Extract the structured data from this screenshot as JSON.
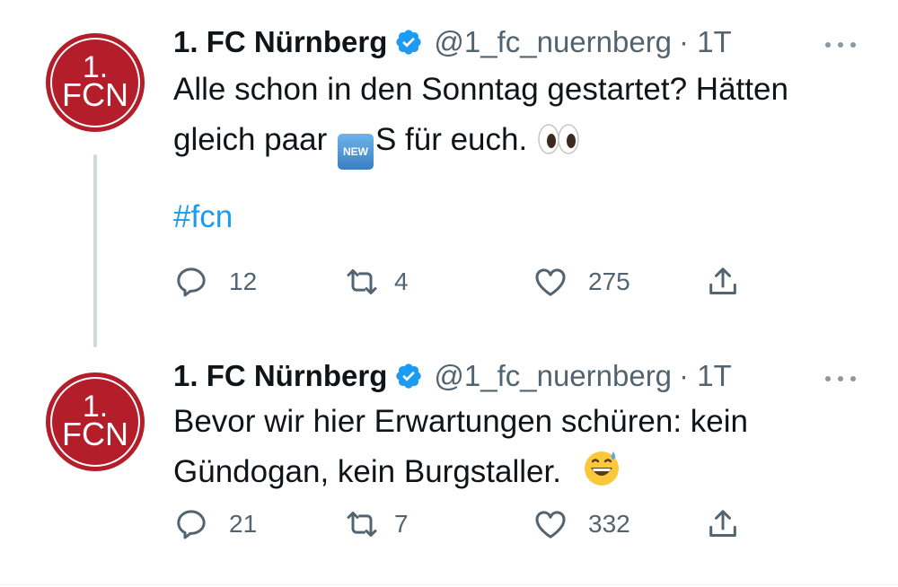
{
  "tweets": [
    {
      "name": "1. FC Nürnberg",
      "handle": "@1_fc_nuernberg",
      "time": "· 1T",
      "text_part1": "Alle schon in den Sonntag gestartet? Hätten",
      "text_part2a": "gleich paar ",
      "new_badge": "NEW",
      "text_part2b": "S für euch.",
      "hashtag": "#fcn",
      "replies": "12",
      "retweets": "4",
      "likes": "275",
      "emoji": "eyes-icon"
    },
    {
      "name": "1. FC Nürnberg",
      "handle": "@1_fc_nuernberg",
      "time": "· 1T",
      "text_part1": "Bevor wir hier Erwartungen schüren: kein",
      "text_part2a": "Gündogan, kein Burgstaller.",
      "replies": "21",
      "retweets": "7",
      "likes": "332",
      "emoji": "grinning-sweat-icon"
    }
  ],
  "avatar_text_top": "1.",
  "avatar_text_bottom": "FCN",
  "colors": {
    "brand_red": "#b41e2a",
    "verified_blue": "#1d9bf0",
    "hashtag_blue": "#1d9bf0",
    "secondary_text": "#536471"
  }
}
